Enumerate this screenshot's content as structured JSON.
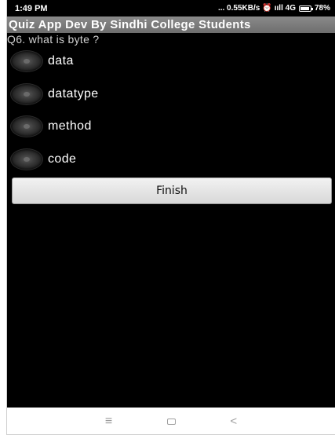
{
  "status_bar": {
    "time": "1:49 PM",
    "network_speed": "... 0.55KB/s",
    "signal": "ııll 4G",
    "battery": "78%"
  },
  "app": {
    "title": "Quiz App Dev By Sindhi College Students"
  },
  "quiz": {
    "question": "Q6. what is byte ?",
    "options": [
      {
        "label": "data",
        "selected": false
      },
      {
        "label": "datatype",
        "selected": false
      },
      {
        "label": "method",
        "selected": false
      },
      {
        "label": "code",
        "selected": false
      }
    ],
    "finish_label": "Finish"
  },
  "nav_bar": {
    "menu_icon": "≡",
    "back_icon": "<"
  }
}
